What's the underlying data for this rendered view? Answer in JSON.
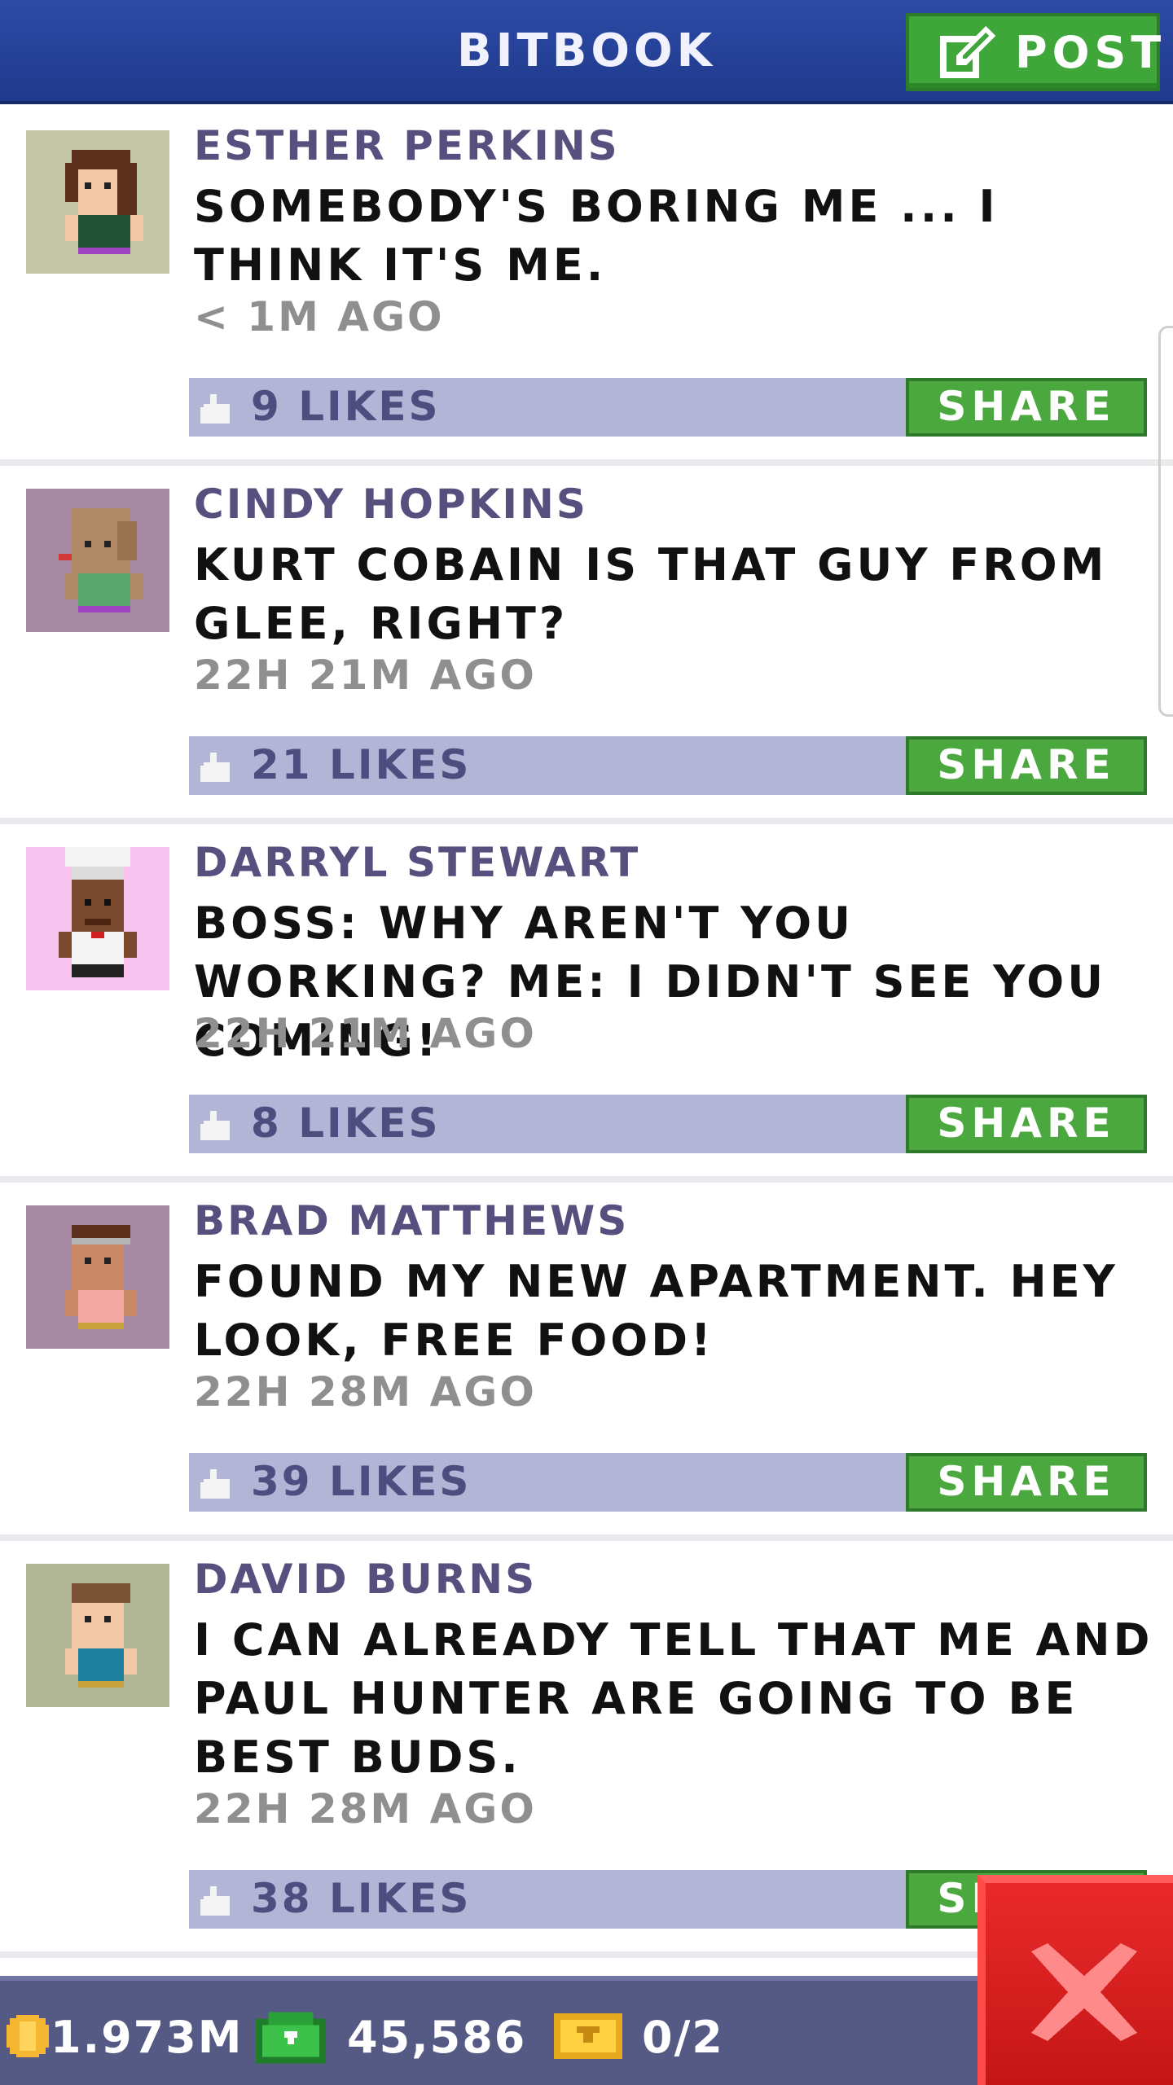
{
  "header": {
    "title": "BITBOOK",
    "post_label": "POST"
  },
  "posts": [
    {
      "author": "ESTHER PERKINS",
      "content": "SOMEBODY'S BORING ME ... I THINK IT'S ME.",
      "time": "< 1M AGO",
      "likes": "9 LIKES",
      "share_label": "SHARE",
      "avatar": "woman-brown-hair-avatar"
    },
    {
      "author": "CINDY HOPKINS",
      "content": "KURT COBAIN IS THAT GUY FROM GLEE, RIGHT?",
      "time": "22H 21M AGO",
      "likes": "21 LIKES",
      "share_label": "SHARE",
      "avatar": "woman-bald-avatar"
    },
    {
      "author": "DARRYL STEWART",
      "content": "BOSS: WHY AREN'T YOU WORKING? ME: I DIDN'T SEE YOU COMING!",
      "time": "22H 21M AGO",
      "likes": "8 LIKES",
      "share_label": "SHARE",
      "avatar": "chef-avatar"
    },
    {
      "author": "BRAD MATTHEWS",
      "content": "FOUND MY NEW APARTMENT. HEY LOOK, FREE FOOD!",
      "time": "22H 28M AGO",
      "likes": "39 LIKES",
      "share_label": "SHARE",
      "avatar": "man-headband-avatar"
    },
    {
      "author": "DAVID BURNS",
      "content": "I CAN ALREADY TELL THAT ME AND PAUL HUNTER ARE GOING TO BE BEST BUDS.",
      "time": "22H 28M AGO",
      "likes": "38 LIKES",
      "share_label": "SHARE",
      "avatar": "man-blue-shirt-avatar"
    }
  ],
  "bottom_bar": {
    "coins": "1.973M",
    "bux": "45,586",
    "tickets": "0/2"
  },
  "colors": {
    "header": "#2d4aa6",
    "accent_green": "#4aa83f",
    "likes_bar": "#b3b5d6",
    "author_text": "#56507f",
    "bottom_bar": "#555a85",
    "close_red": "#d81f1f"
  }
}
